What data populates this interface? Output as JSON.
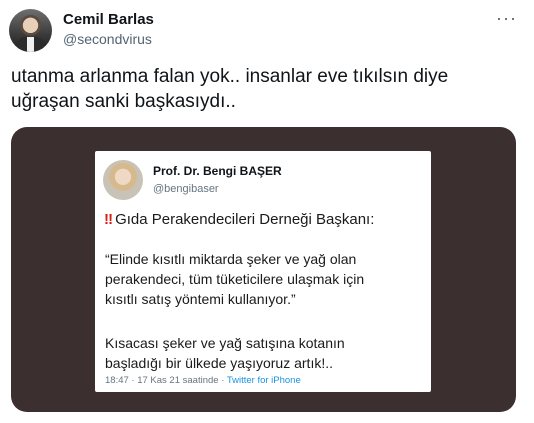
{
  "author": {
    "name": "Cemil Barlas",
    "handle": "@secondvirus"
  },
  "more_icon": "more-horizontal-icon",
  "tweet": {
    "text_line1": "utanma arlanma falan yok.. insanlar eve tıkılsın diye",
    "text_line2": "uğraşan sanki başkasıydı.."
  },
  "embedded": {
    "name": "Prof. Dr. Bengi BAŞER",
    "handle": "@bengibaser",
    "heading_mark": "‼",
    "heading": "Gıda Perakendecileri Derneği Başkanı:",
    "quote_line1": "“Elinde kısıtlı miktarda şeker ve yağ olan",
    "quote_line2": "perakendeci, tüm tüketicilere ulaşmak için",
    "quote_line3": "kısıtlı satış yöntemi kullanıyor.”",
    "conclusion_line1": "Kısacası şeker ve yağ satışına kotanın",
    "conclusion_line2": "başladığı bir ülkede yaşıyoruz artık!..",
    "meta_time": "18:47 · 17 Kas 21 saatinde · ",
    "meta_source": "Twitter for iPhone"
  }
}
